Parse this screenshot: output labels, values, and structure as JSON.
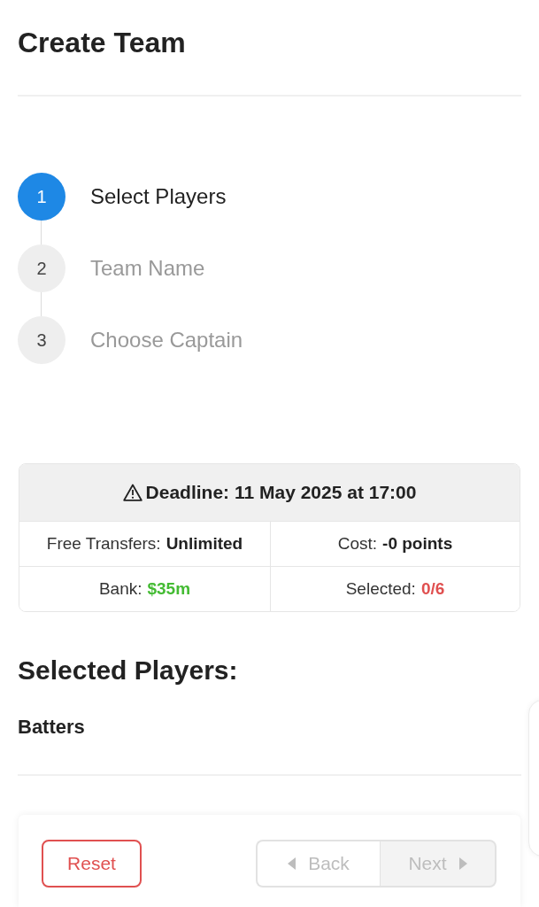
{
  "header": {
    "title": "Create Team"
  },
  "steps": [
    {
      "number": "1",
      "label": "Select Players",
      "selected": true
    },
    {
      "number": "2",
      "label": "Team Name",
      "selected": false
    },
    {
      "number": "3",
      "label": "Choose Captain",
      "selected": false
    }
  ],
  "summary": {
    "deadline": "Deadline: 11 May 2025 at 17:00",
    "rows": [
      {
        "cells": [
          {
            "label": "Free Transfers:",
            "value": "Unlimited",
            "kind": "bold"
          },
          {
            "label": "Cost:",
            "value": "-0 points",
            "kind": "bold"
          }
        ]
      },
      {
        "cells": [
          {
            "label": "Bank:",
            "value": "$35m",
            "kind": "success"
          },
          {
            "label": "Selected:",
            "value": "0/6",
            "kind": "danger"
          }
        ]
      }
    ]
  },
  "selected_players": {
    "title": "Selected Players:",
    "groups": [
      {
        "title": "Batters"
      }
    ]
  },
  "actions": {
    "reset": {
      "label": "Reset"
    },
    "navigation": [
      {
        "label": "Back",
        "kind": "back",
        "disabled": true
      },
      {
        "label": "Next",
        "kind": "next",
        "disabled": true
      }
    ]
  }
}
